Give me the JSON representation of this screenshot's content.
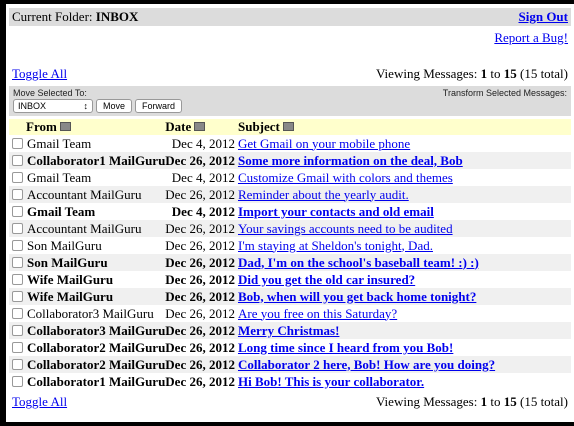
{
  "header": {
    "folder_label": "Current Folder:",
    "folder_name": "INBOX",
    "sign_out": "Sign Out",
    "report_bug": "Report a Bug!"
  },
  "nav": {
    "toggle_all": "Toggle All",
    "viewing_prefix": "Viewing Messages:",
    "range_start": "1",
    "range_to": "to",
    "range_end": "15",
    "total": "(15 total)"
  },
  "controls": {
    "move_label": "Move Selected To:",
    "folder_select": "INBOX",
    "move_button": "Move",
    "forward_button": "Forward",
    "transform_label": "Transform Selected Messages:"
  },
  "columns": {
    "from": "From",
    "date": "Date",
    "subject": "Subject"
  },
  "messages": [
    {
      "from": "Gmail Team",
      "date": "Dec 4, 2012",
      "subject": "Get Gmail on your mobile phone",
      "unread": false
    },
    {
      "from": "Collaborator1 MailGuru",
      "date": "Dec 26, 2012",
      "subject": "Some more information on the deal, Bob",
      "unread": true
    },
    {
      "from": "Gmail Team",
      "date": "Dec 4, 2012",
      "subject": "Customize Gmail with colors and themes",
      "unread": false
    },
    {
      "from": "Accountant MailGuru",
      "date": "Dec 26, 2012",
      "subject": "Reminder about the yearly audit.",
      "unread": false
    },
    {
      "from": "Gmail Team",
      "date": "Dec 4, 2012",
      "subject": "Import your contacts and old email",
      "unread": true
    },
    {
      "from": "Accountant MailGuru",
      "date": "Dec 26, 2012",
      "subject": "Your savings accounts need to be audited",
      "unread": false
    },
    {
      "from": "Son MailGuru",
      "date": "Dec 26, 2012",
      "subject": "I'm staying at Sheldon's tonight, Dad.",
      "unread": false
    },
    {
      "from": "Son MailGuru",
      "date": "Dec 26, 2012",
      "subject": "Dad, I'm on the school's baseball team! :) :)",
      "unread": true
    },
    {
      "from": "Wife MailGuru",
      "date": "Dec 26, 2012",
      "subject": "Did you get the old car insured?",
      "unread": true
    },
    {
      "from": "Wife MailGuru",
      "date": "Dec 26, 2012",
      "subject": "Bob, when will you get back home tonight?",
      "unread": true
    },
    {
      "from": "Collaborator3 MailGuru",
      "date": "Dec 26, 2012",
      "subject": "Are you free on this Saturday?",
      "unread": false
    },
    {
      "from": "Collaborator3 MailGuru",
      "date": "Dec 26, 2012",
      "subject": "Merry Christmas!",
      "unread": true
    },
    {
      "from": "Collaborator2 MailGuru",
      "date": "Dec 26, 2012",
      "subject": "Long time since I heard from you Bob!",
      "unread": true
    },
    {
      "from": "Collaborator2 MailGuru",
      "date": "Dec 26, 2012",
      "subject": "Collaborator 2 here, Bob! How are you doing?",
      "unread": true
    },
    {
      "from": "Collaborator1 MailGuru",
      "date": "Dec 26, 2012",
      "subject": "Hi Bob! This is your collaborator.",
      "unread": true
    }
  ]
}
